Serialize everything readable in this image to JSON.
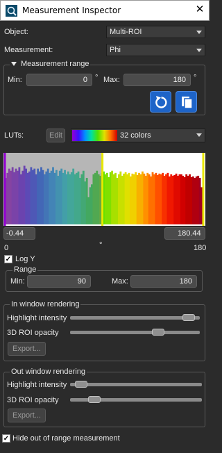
{
  "window": {
    "title": "Measurement Inspector",
    "close_glyph": "✕"
  },
  "object": {
    "label": "Object:",
    "value": "Multi-ROI"
  },
  "measurement": {
    "label": "Measurement:",
    "value": "Phi"
  },
  "measurement_range": {
    "title": "Measurement range",
    "min_label": "Min:",
    "min_value": "0",
    "min_unit": "°",
    "max_label": "Max:",
    "max_value": "180",
    "max_unit": "°",
    "reset_icon": "reset-icon",
    "copy_icon": "copy-icon"
  },
  "luts": {
    "label": "LUTs:",
    "edit_label": "Edit",
    "value": "32 colors"
  },
  "histogram": {
    "lower_readout": "-0.44",
    "upper_readout": "180.44",
    "axis_min": "0",
    "axis_unit": "°",
    "axis_max": "180",
    "marker_fraction": 0.49,
    "left_marker_color": "#9400d3",
    "right_marker_color": "#e8e800",
    "bins": [
      0.35,
      0.28,
      0.22,
      0.25,
      0.2,
      0.27,
      0.22,
      0.25,
      0.2,
      0.3,
      0.25,
      0.18,
      0.22,
      0.28,
      0.26,
      0.2,
      0.24,
      0.22,
      0.3,
      0.22,
      0.26,
      0.2,
      0.24,
      0.3,
      0.26,
      0.22,
      0.28,
      0.25,
      0.2,
      0.28,
      0.24,
      0.32,
      0.25,
      0.22,
      0.28,
      0.24,
      0.3,
      0.26,
      0.3,
      0.27,
      0.22,
      0.3,
      0.28,
      0.26,
      0.35,
      0.3,
      0.25,
      0.4,
      0.35,
      0.62,
      0.48,
      0.44,
      0.3,
      0.28,
      0.25,
      0.3,
      0.32,
      0.28,
      0.26,
      0.3,
      0.28,
      0.34,
      0.27,
      0.25,
      0.3,
      0.28,
      0.35,
      0.3,
      0.26,
      0.32,
      0.29,
      0.27,
      0.3,
      0.28,
      0.33,
      0.29,
      0.3,
      0.27,
      0.31,
      0.28,
      0.3,
      0.26,
      0.29,
      0.32,
      0.28,
      0.3,
      0.33,
      0.27,
      0.3,
      0.28,
      0.31,
      0.29,
      0.3,
      0.28,
      0.32,
      0.3,
      0.28,
      0.33,
      0.3,
      0.32,
      0.31,
      0.29,
      0.32,
      0.3,
      0.3,
      0.32,
      0.34,
      0.3,
      0.32,
      0.3,
      0.34,
      0.33,
      0.35,
      0.33,
      0.32,
      0.35,
      0.48,
      0.3
    ],
    "colors": [
      "#9400d3",
      "#7a00e0",
      "#5a00f0",
      "#3a10ff",
      "#1a30ff",
      "#0050ff",
      "#0070ff",
      "#0090ff",
      "#00b0f0",
      "#00cce0",
      "#00dcc0",
      "#00e0a0",
      "#00e070",
      "#00e040",
      "#20e020",
      "#50e000",
      "#80e000",
      "#a8e000",
      "#c8e000",
      "#e0e000",
      "#f0d000",
      "#f8b000",
      "#ff9000",
      "#ff7000",
      "#ff5000",
      "#f83000",
      "#f01800",
      "#e00a00",
      "#d00000",
      "#c00000",
      "#b00010",
      "#a00020"
    ]
  },
  "log_y": {
    "label": "Log Y",
    "checked": true
  },
  "range": {
    "title": "Range",
    "min_label": "Min:",
    "min_value": "90",
    "max_label": "Max:",
    "max_value": "180"
  },
  "in_window": {
    "title": "In window rendering",
    "highlight_label": "Highlight intensity",
    "highlight_level": 0.96,
    "opacity_label": "3D ROI opacity",
    "opacity_level": 0.7,
    "export_label": "Export..."
  },
  "out_window": {
    "title": "Out window rendering",
    "highlight_label": "Highlight intensity",
    "highlight_level": 0.04,
    "opacity_label": "3D ROI opacity",
    "opacity_level": 0.15,
    "export_label": "Export..."
  },
  "hide_out_of_range": {
    "label": "Hide out of range measurement",
    "checked": true
  }
}
